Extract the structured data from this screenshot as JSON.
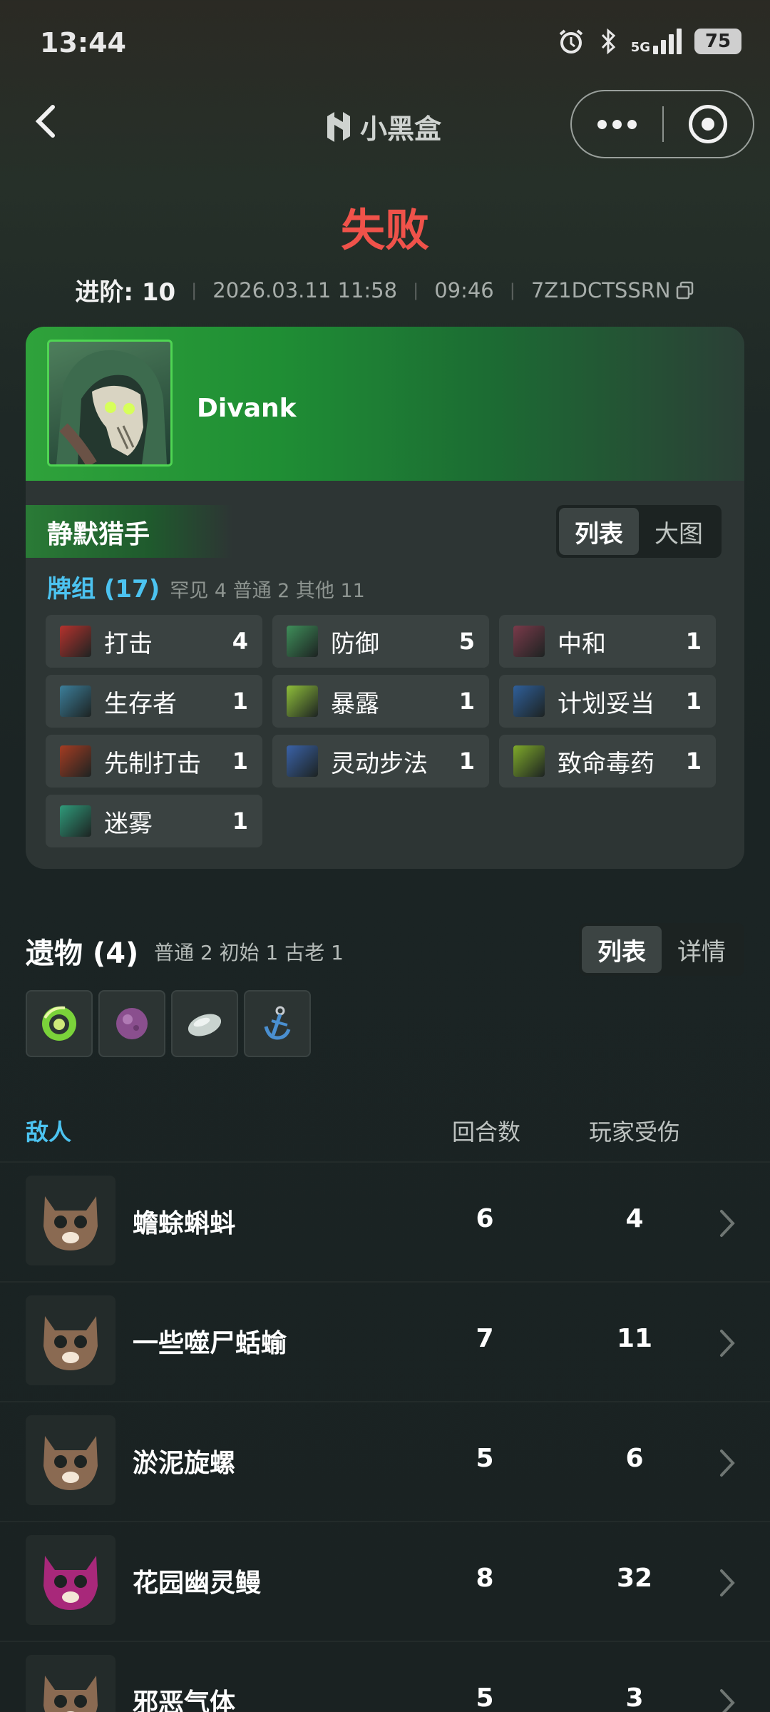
{
  "status_bar": {
    "time": "13:44",
    "network": "5G",
    "battery": "75"
  },
  "nav": {
    "brand": "小黑盒"
  },
  "result": "失败",
  "meta": {
    "ascension": "进阶: 10",
    "datetime": "2026.03.11 11:58",
    "duration": "09:46",
    "seed": "7Z1DCTSSRN"
  },
  "hero": {
    "name": "Divank",
    "class_name": "静默猎手"
  },
  "deck_view": {
    "tab_list": "列表",
    "tab_grid": "大图",
    "active": "列表"
  },
  "deck": {
    "title": "牌组 (17)",
    "stats": "罕见 4  普通 2  其他 11",
    "cards": [
      {
        "name": "打击",
        "count": "4",
        "icon": "strike-card-icon",
        "color": "#b5322d"
      },
      {
        "name": "防御",
        "count": "5",
        "icon": "defend-card-icon",
        "color": "#3f8f5a"
      },
      {
        "name": "中和",
        "count": "1",
        "icon": "neutralize-card-icon",
        "color": "#7a3a4a"
      },
      {
        "name": "生存者",
        "count": "1",
        "icon": "survivor-card-icon",
        "color": "#3c7e9a"
      },
      {
        "name": "暴露",
        "count": "1",
        "icon": "expose-card-icon",
        "color": "#8fbf3a"
      },
      {
        "name": "计划妥当",
        "count": "1",
        "icon": "well-laid-plans-card-icon",
        "color": "#2f5f9a"
      },
      {
        "name": "先制打击",
        "count": "1",
        "icon": "preemptive-strike-card-icon",
        "color": "#a43c22"
      },
      {
        "name": "灵动步法",
        "count": "1",
        "icon": "footwork-card-icon",
        "color": "#3a62a8"
      },
      {
        "name": "致命毒药",
        "count": "1",
        "icon": "deadly-poison-card-icon",
        "color": "#7faa2a"
      },
      {
        "name": "迷雾",
        "count": "1",
        "icon": "fog-card-icon",
        "color": "#2f9a7a"
      }
    ]
  },
  "relics": {
    "title": "遗物 (4)",
    "stats": "普通 2  初始 1  古老 1",
    "tab_list": "列表",
    "tab_detail": "详情",
    "items": [
      {
        "icon": "ring-of-snake-relic-icon",
        "color": "#7ad23a"
      },
      {
        "icon": "orb-relic-icon",
        "color": "#8a4f8e"
      },
      {
        "icon": "stone-relic-icon",
        "color": "#c9d3cf"
      },
      {
        "icon": "anchor-relic-icon",
        "color": "#4a8fd0"
      }
    ]
  },
  "enemies": {
    "header_name": "敌人",
    "header_rounds": "回合数",
    "header_damage": "玩家受伤",
    "rows": [
      {
        "name": "蟾蜍蝌蚪",
        "rounds": "6",
        "damage": "4",
        "icon": "monster-face-icon",
        "color": "#8a6a52"
      },
      {
        "name": "一些噬尸蛞蝓",
        "rounds": "7",
        "damage": "11",
        "icon": "monster-face-icon",
        "color": "#8a6a52"
      },
      {
        "name": "淤泥旋螺",
        "rounds": "5",
        "damage": "6",
        "icon": "monster-face-icon",
        "color": "#8a6a52"
      },
      {
        "name": "花园幽灵鳗",
        "rounds": "8",
        "damage": "32",
        "icon": "elite-monster-face-icon",
        "color": "#a8287a"
      },
      {
        "name": "邪恶气体",
        "rounds": "5",
        "damage": "3",
        "icon": "monster-face-icon",
        "color": "#8a6a52"
      }
    ]
  }
}
